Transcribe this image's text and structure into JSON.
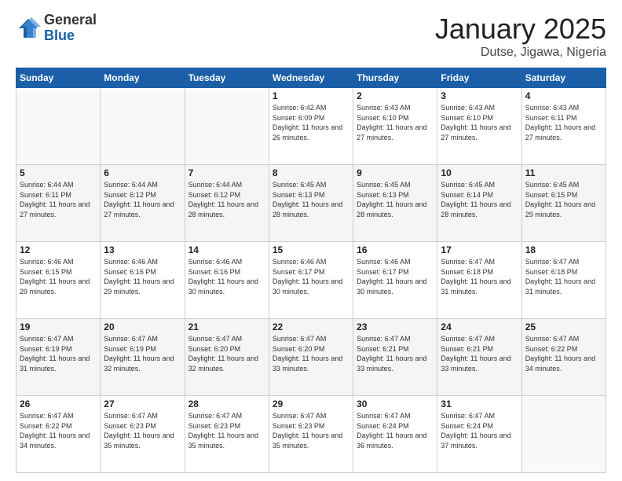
{
  "logo": {
    "general": "General",
    "blue": "Blue"
  },
  "title": "January 2025",
  "subtitle": "Dutse, Jigawa, Nigeria",
  "days_of_week": [
    "Sunday",
    "Monday",
    "Tuesday",
    "Wednesday",
    "Thursday",
    "Friday",
    "Saturday"
  ],
  "weeks": [
    [
      {
        "day": "",
        "info": ""
      },
      {
        "day": "",
        "info": ""
      },
      {
        "day": "",
        "info": ""
      },
      {
        "day": "1",
        "info": "Sunrise: 6:42 AM\nSunset: 6:09 PM\nDaylight: 11 hours and 26 minutes."
      },
      {
        "day": "2",
        "info": "Sunrise: 6:43 AM\nSunset: 6:10 PM\nDaylight: 11 hours and 27 minutes."
      },
      {
        "day": "3",
        "info": "Sunrise: 6:43 AM\nSunset: 6:10 PM\nDaylight: 11 hours and 27 minutes."
      },
      {
        "day": "4",
        "info": "Sunrise: 6:43 AM\nSunset: 6:11 PM\nDaylight: 11 hours and 27 minutes."
      }
    ],
    [
      {
        "day": "5",
        "info": "Sunrise: 6:44 AM\nSunset: 6:11 PM\nDaylight: 11 hours and 27 minutes."
      },
      {
        "day": "6",
        "info": "Sunrise: 6:44 AM\nSunset: 6:12 PM\nDaylight: 11 hours and 27 minutes."
      },
      {
        "day": "7",
        "info": "Sunrise: 6:44 AM\nSunset: 6:12 PM\nDaylight: 11 hours and 28 minutes."
      },
      {
        "day": "8",
        "info": "Sunrise: 6:45 AM\nSunset: 6:13 PM\nDaylight: 11 hours and 28 minutes."
      },
      {
        "day": "9",
        "info": "Sunrise: 6:45 AM\nSunset: 6:13 PM\nDaylight: 11 hours and 28 minutes."
      },
      {
        "day": "10",
        "info": "Sunrise: 6:45 AM\nSunset: 6:14 PM\nDaylight: 11 hours and 28 minutes."
      },
      {
        "day": "11",
        "info": "Sunrise: 6:45 AM\nSunset: 6:15 PM\nDaylight: 11 hours and 29 minutes."
      }
    ],
    [
      {
        "day": "12",
        "info": "Sunrise: 6:46 AM\nSunset: 6:15 PM\nDaylight: 11 hours and 29 minutes."
      },
      {
        "day": "13",
        "info": "Sunrise: 6:46 AM\nSunset: 6:16 PM\nDaylight: 11 hours and 29 minutes."
      },
      {
        "day": "14",
        "info": "Sunrise: 6:46 AM\nSunset: 6:16 PM\nDaylight: 11 hours and 30 minutes."
      },
      {
        "day": "15",
        "info": "Sunrise: 6:46 AM\nSunset: 6:17 PM\nDaylight: 11 hours and 30 minutes."
      },
      {
        "day": "16",
        "info": "Sunrise: 6:46 AM\nSunset: 6:17 PM\nDaylight: 11 hours and 30 minutes."
      },
      {
        "day": "17",
        "info": "Sunrise: 6:47 AM\nSunset: 6:18 PM\nDaylight: 11 hours and 31 minutes."
      },
      {
        "day": "18",
        "info": "Sunrise: 6:47 AM\nSunset: 6:18 PM\nDaylight: 11 hours and 31 minutes."
      }
    ],
    [
      {
        "day": "19",
        "info": "Sunrise: 6:47 AM\nSunset: 6:19 PM\nDaylight: 11 hours and 31 minutes."
      },
      {
        "day": "20",
        "info": "Sunrise: 6:47 AM\nSunset: 6:19 PM\nDaylight: 11 hours and 32 minutes."
      },
      {
        "day": "21",
        "info": "Sunrise: 6:47 AM\nSunset: 6:20 PM\nDaylight: 11 hours and 32 minutes."
      },
      {
        "day": "22",
        "info": "Sunrise: 6:47 AM\nSunset: 6:20 PM\nDaylight: 11 hours and 33 minutes."
      },
      {
        "day": "23",
        "info": "Sunrise: 6:47 AM\nSunset: 6:21 PM\nDaylight: 11 hours and 33 minutes."
      },
      {
        "day": "24",
        "info": "Sunrise: 6:47 AM\nSunset: 6:21 PM\nDaylight: 11 hours and 33 minutes."
      },
      {
        "day": "25",
        "info": "Sunrise: 6:47 AM\nSunset: 6:22 PM\nDaylight: 11 hours and 34 minutes."
      }
    ],
    [
      {
        "day": "26",
        "info": "Sunrise: 6:47 AM\nSunset: 6:22 PM\nDaylight: 11 hours and 34 minutes."
      },
      {
        "day": "27",
        "info": "Sunrise: 6:47 AM\nSunset: 6:23 PM\nDaylight: 11 hours and 35 minutes."
      },
      {
        "day": "28",
        "info": "Sunrise: 6:47 AM\nSunset: 6:23 PM\nDaylight: 11 hours and 35 minutes."
      },
      {
        "day": "29",
        "info": "Sunrise: 6:47 AM\nSunset: 6:23 PM\nDaylight: 11 hours and 35 minutes."
      },
      {
        "day": "30",
        "info": "Sunrise: 6:47 AM\nSunset: 6:24 PM\nDaylight: 11 hours and 36 minutes."
      },
      {
        "day": "31",
        "info": "Sunrise: 6:47 AM\nSunset: 6:24 PM\nDaylight: 11 hours and 37 minutes."
      },
      {
        "day": "",
        "info": ""
      }
    ]
  ]
}
